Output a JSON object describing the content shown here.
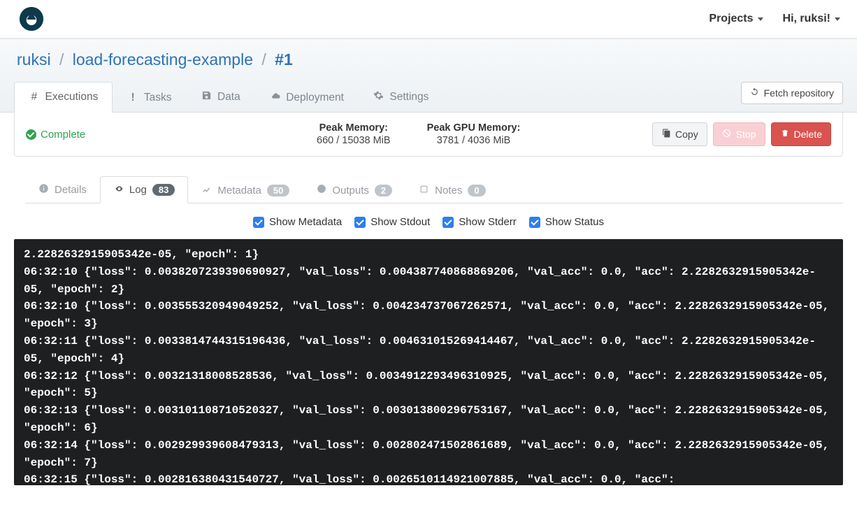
{
  "topnav": {
    "projects_label": "Projects",
    "greeting": "Hi, ruksi!"
  },
  "breadcrumb": {
    "owner": "ruksi",
    "project": "load-forecasting-example",
    "run": "#1"
  },
  "nav_tabs": {
    "executions": "Executions",
    "tasks": "Tasks",
    "data": "Data",
    "deployment": "Deployment",
    "settings": "Settings",
    "fetch_repo": "Fetch repository"
  },
  "status": {
    "state": "Complete",
    "peak_mem_label": "Peak Memory:",
    "peak_mem_value": "660 / 15038 MiB",
    "peak_gpu_label": "Peak GPU Memory:",
    "peak_gpu_value": "3781 / 4036 MiB",
    "copy": "Copy",
    "stop": "Stop",
    "delete": "Delete"
  },
  "subtabs": {
    "details": "Details",
    "log": "Log",
    "log_badge": "83",
    "metadata": "Metadata",
    "metadata_badge": "50",
    "outputs": "Outputs",
    "outputs_badge": "2",
    "notes": "Notes",
    "notes_badge": "0"
  },
  "filters": {
    "meta": "Show Metadata",
    "stdout": "Show Stdout",
    "stderr": "Show Stderr",
    "status": "Show Status"
  },
  "log_text": "2.2282632915905342e-05, \"epoch\": 1}\n06:32:10 {\"loss\": 0.0038207239390690927, \"val_loss\": 0.004387740868869206, \"val_acc\": 0.0, \"acc\": 2.2282632915905342e-05, \"epoch\": 2}\n06:32:10 {\"loss\": 0.003555320949049252, \"val_loss\": 0.004234737067262571, \"val_acc\": 0.0, \"acc\": 2.2282632915905342e-05, \"epoch\": 3}\n06:32:11 {\"loss\": 0.0033814744315196436, \"val_loss\": 0.004631015269414467, \"val_acc\": 0.0, \"acc\": 2.2282632915905342e-05, \"epoch\": 4}\n06:32:12 {\"loss\": 0.00321318008528536, \"val_loss\": 0.0034912293496310925, \"val_acc\": 0.0, \"acc\": 2.2282632915905342e-05, \"epoch\": 5}\n06:32:13 {\"loss\": 0.003101108710520327, \"val_loss\": 0.003013800296753167, \"val_acc\": 0.0, \"acc\": 2.2282632915905342e-05, \"epoch\": 6}\n06:32:14 {\"loss\": 0.002929939608479313, \"val_loss\": 0.002802471502861689, \"val_acc\": 0.0, \"acc\": 2.2282632915905342e-05, \"epoch\": 7}\n06:32:15 {\"loss\": 0.002816380431540727, \"val_loss\": 0.0026510114921007885, \"val_acc\": 0.0, \"acc\":"
}
